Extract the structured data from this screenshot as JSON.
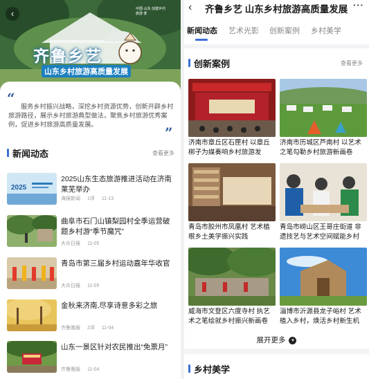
{
  "left": {
    "banner": {
      "back_icon": "back-arrow-icon",
      "badge_text": "中国·山东 创建乡村旅游 季",
      "title": "齐鲁乡艺",
      "subtitle": "山东乡村旅游高质量发展"
    },
    "intro": "服务乡村振兴战略，深挖乡村资源优势，创新开辟乡村旅游路径，展示乡村旅游典型做法，聚焦乡村旅游优秀案例，促进乡村旅游高质量发展。",
    "news_section": {
      "title": "新闻动态",
      "more": "查看更多",
      "items": [
        {
          "title": "2025山东生态旅游推进活动在济南莱芜举办",
          "source": "海报新闻",
          "comments": "1评",
          "date": "11-13",
          "thumb_text": "2025"
        },
        {
          "title": "曲阜市石门山镇梨园村全季运营破题乡村游“季节魔咒”",
          "source": "大众日报",
          "comments": "",
          "date": "11-05"
        },
        {
          "title": "青岛市第三届乡村运动嘉年华收官",
          "source": "大众日报",
          "comments": "",
          "date": "11-05"
        },
        {
          "title": "金秋来济南,尽享诗意多彩之旅",
          "source": "齐鲁晚报",
          "comments": "2评",
          "date": "11-04"
        },
        {
          "title": "山东一景区针对农民推出“免票月”",
          "source": "齐鲁晚报",
          "comments": "",
          "date": "11-04"
        }
      ]
    }
  },
  "right": {
    "header": {
      "back_icon": "back-arrow-icon",
      "title": "齐鲁乡艺 山东乡村旅游高质量发展",
      "more_icon": "more-dots-icon"
    },
    "tabs": [
      {
        "label": "新闻动态",
        "active": true
      },
      {
        "label": "艺术光影",
        "active": false
      },
      {
        "label": "创新案例",
        "active": false
      },
      {
        "label": "乡村美学",
        "active": false
      }
    ],
    "cases_section": {
      "title": "创新案例",
      "more": "查看更多",
      "items": [
        {
          "caption": "济南市章丘区石匣村 以章丘梆子为媒奏响乡村旅游发展“交响曲”"
        },
        {
          "caption": "济南市历城区芦南村 以艺术之笔勾勒乡村旅游新画卷"
        },
        {
          "caption": "青岛市胶州市凤凰村 艺术植根乡土美学振兴实践"
        },
        {
          "caption": "青岛市崂山区王哥庄街道 非遗技艺与艺术空间赋能乡村"
        },
        {
          "caption": "威海市文登区六度寺村 执艺术之笔绘就乡村振兴新画卷"
        },
        {
          "caption": "淄博市沂源县龙子峪村 艺术植入乡村，焕活乡村新生机"
        }
      ],
      "expand_label": "展开更多",
      "expand_icon": "chevron-down-icon"
    },
    "aesthetics_section": {
      "title": "乡村美学"
    }
  }
}
